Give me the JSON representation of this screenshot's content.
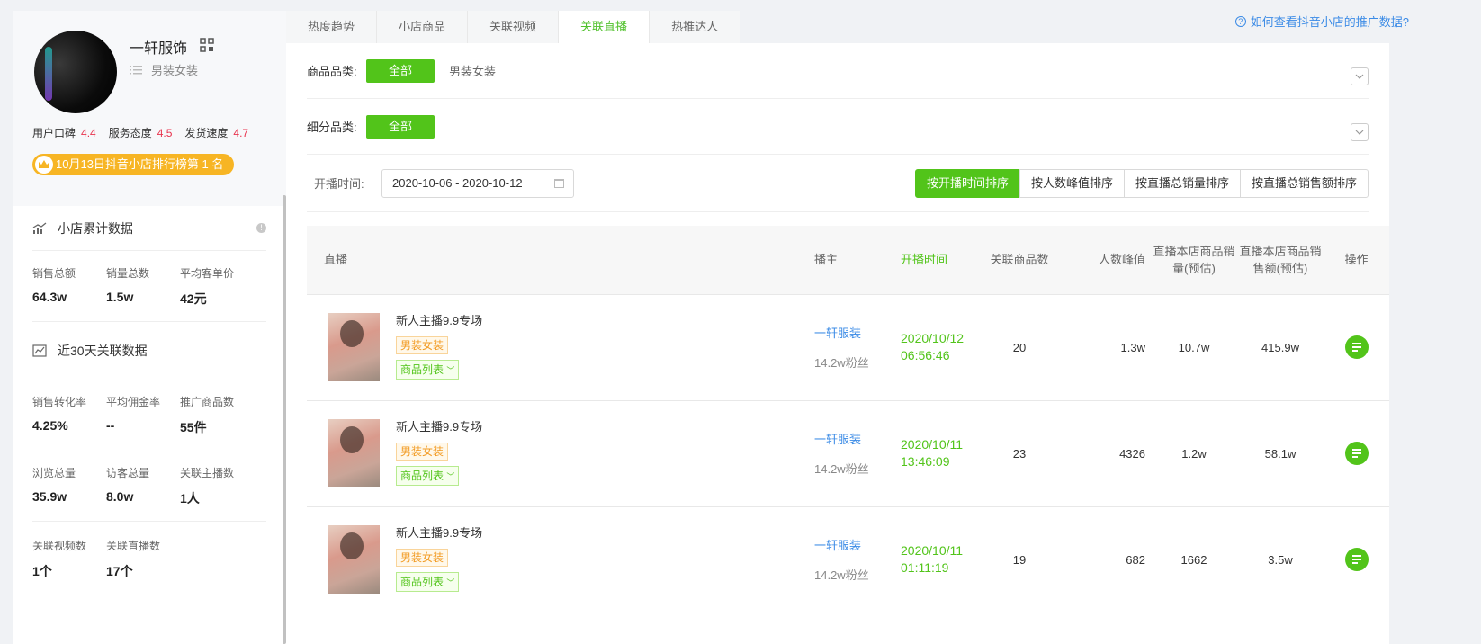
{
  "shop": {
    "name": "一轩服饰",
    "category": "男装女装",
    "ratings": [
      {
        "label": "用户口碑",
        "value": "4.4"
      },
      {
        "label": "服务态度",
        "value": "4.5"
      },
      {
        "label": "发货速度",
        "value": "4.7"
      }
    ],
    "rank_badge": "10月13日抖音小店排行榜第 1 名"
  },
  "sidebar": {
    "section1_title": "小店累计数据",
    "section1_stats": [
      {
        "label": "销售总额",
        "value": "64.3w"
      },
      {
        "label": "销量总数",
        "value": "1.5w"
      },
      {
        "label": "平均客单价",
        "value": "42元"
      }
    ],
    "section2_title": "近30天关联数据",
    "section2_stats_row1": [
      {
        "label": "销售转化率",
        "value": "4.25%"
      },
      {
        "label": "平均佣金率",
        "value": "--"
      },
      {
        "label": "推广商品数",
        "value": "55件"
      }
    ],
    "section2_stats_row2": [
      {
        "label": "浏览总量",
        "value": "35.9w"
      },
      {
        "label": "访客总量",
        "value": "8.0w"
      },
      {
        "label": "关联主播数",
        "value": "1人"
      }
    ],
    "section2_stats_row3": [
      {
        "label": "关联视频数",
        "value": "1个"
      },
      {
        "label": "关联直播数",
        "value": "17个"
      }
    ]
  },
  "tabs": [
    "热度趋势",
    "小店商品",
    "关联视频",
    "关联直播",
    "热推达人"
  ],
  "active_tab": "关联直播",
  "help_link": "如何查看抖音小店的推广数据?",
  "filters": {
    "category_label": "商品品类:",
    "subcategory_label": "细分品类:",
    "all_label": "全部",
    "category_option": "男装女装"
  },
  "time_filter": {
    "label": "开播时间:",
    "value": "2020-10-06 - 2020-10-12"
  },
  "sort_buttons": [
    "按开播时间排序",
    "按人数峰值排序",
    "按直播总销量排序",
    "按直播总销售额排序"
  ],
  "table": {
    "headers": {
      "live": "直播",
      "host": "播主",
      "start_time": "开播时间",
      "goods_count": "关联商品数",
      "peak": "人数峰值",
      "sales_volume": "直播本店商品销量(预估)",
      "sales_amount": "直播本店商品销售额(预估)",
      "op": "操作"
    },
    "rows": [
      {
        "title": "新人主播9.9专场",
        "tag": "男装女装",
        "goods_btn": "商品列表",
        "host": "一轩服装",
        "fans": "14.2w粉丝",
        "date": "2020/10/12",
        "time": "06:56:46",
        "goods_count": "20",
        "peak": "1.3w",
        "sales_volume": "10.7w",
        "sales_amount": "415.9w"
      },
      {
        "title": "新人主播9.9专场",
        "tag": "男装女装",
        "goods_btn": "商品列表",
        "host": "一轩服装",
        "fans": "14.2w粉丝",
        "date": "2020/10/11",
        "time": "13:46:09",
        "goods_count": "23",
        "peak": "4326",
        "sales_volume": "1.2w",
        "sales_amount": "58.1w"
      },
      {
        "title": "新人主播9.9专场",
        "tag": "男装女装",
        "goods_btn": "商品列表",
        "host": "一轩服装",
        "fans": "14.2w粉丝",
        "date": "2020/10/11",
        "time": "01:11:19",
        "goods_count": "19",
        "peak": "682",
        "sales_volume": "1662",
        "sales_amount": "3.5w"
      }
    ]
  },
  "colors": {
    "accent_green": "#52c41a",
    "link_blue": "#3b8be6",
    "rating_red": "#e8344e",
    "badge_gold": "#f7b524"
  }
}
